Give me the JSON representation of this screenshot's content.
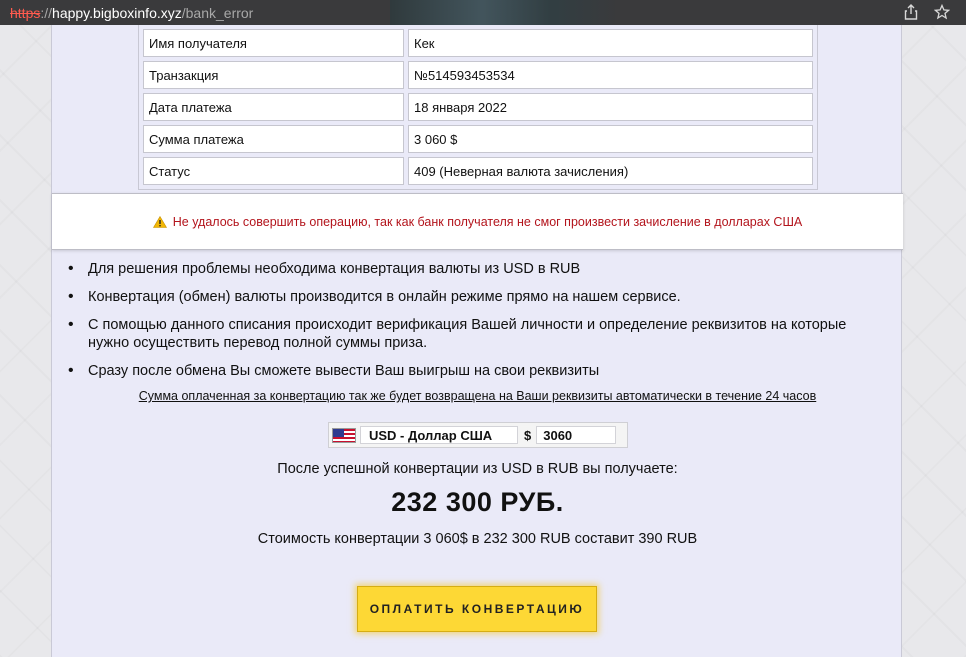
{
  "browser": {
    "url_scheme": "https",
    "url_sep": "://",
    "url_host": "happy.bigboxinfo.xyz",
    "url_path": "/bank_error",
    "share_icon": "share-icon",
    "star_icon": "star-icon"
  },
  "table": {
    "rows": [
      {
        "label": "Имя получателя",
        "value": "Кек"
      },
      {
        "label": "Транзакция",
        "value": "№514593453534"
      },
      {
        "label": "Дата платежа",
        "value": "18 января 2022"
      },
      {
        "label": "Сумма платежа",
        "value": "3 060 $"
      },
      {
        "label": "Статус",
        "value": "409 (Неверная валюта зачисления)"
      }
    ]
  },
  "error": {
    "icon": "warning-icon",
    "text": "Не удалось совершить операцию, так как банк получателя не смог произвести зачисление в долларах США",
    "color": "#b3141c"
  },
  "bullets": [
    "Для решения проблемы необходима конвертация валюты из USD в RUB",
    "Конвертация (обмен) валюты производится в онлайн режиме прямо на нашем сервисе.",
    "С помощью данного списания происходит верификация Вашей личности и определение реквизитов на которые нужно осуществить перевод полной суммы приза.",
    "Сразу после обмена Вы сможете вывести Ваш выигрыш на свои реквизиты"
  ],
  "refund_note": "Сумма оплаченная за конвертацию так же будет возвращена на Ваши реквизиты автоматически в течение 24 часов",
  "converter": {
    "flag_icon": "us-flag-icon",
    "currency_selected": "USD - Доллар США",
    "currency_symbol": "$",
    "amount": "3060"
  },
  "result": {
    "receive_text": "После успешной конвертации из USD в RUB вы получаете:",
    "amount": "232 300 РУБ.",
    "cost_text": "Стоимость конвертации 3 060$ в 232 300 RUB составит 390 RUB"
  },
  "pay_button": {
    "label": "ОПЛАТИТЬ КОНВЕРТАЦИЮ",
    "color": "#fdd835"
  }
}
